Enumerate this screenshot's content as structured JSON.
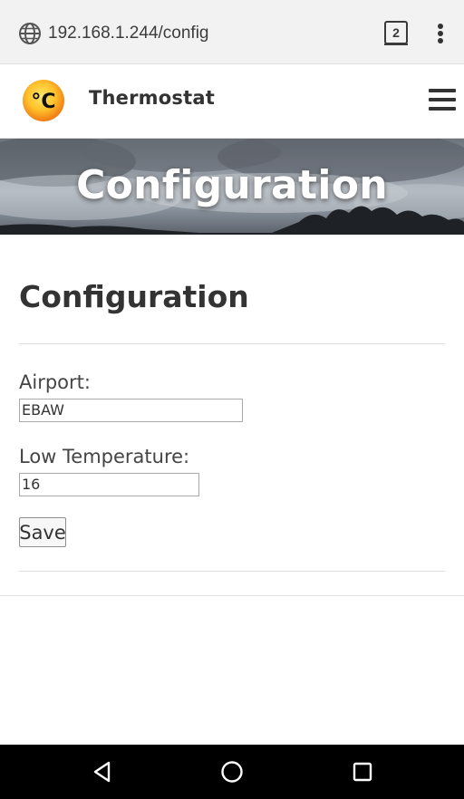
{
  "browser": {
    "url": "192.168.1.244/config",
    "tab_count": "2"
  },
  "header": {
    "logo_text": "°C",
    "site_title": "Thermostat"
  },
  "banner": {
    "title": "Configuration"
  },
  "main": {
    "heading": "Configuration",
    "airport_label": "Airport:",
    "airport_value": "EBAW",
    "low_temp_label": "Low Temperature:",
    "low_temp_value": "16",
    "save_label": "Save"
  },
  "colors": {
    "logo_orange": "#f7a21c",
    "logo_yellow": "#ffd54a",
    "text_dark": "#333333"
  }
}
